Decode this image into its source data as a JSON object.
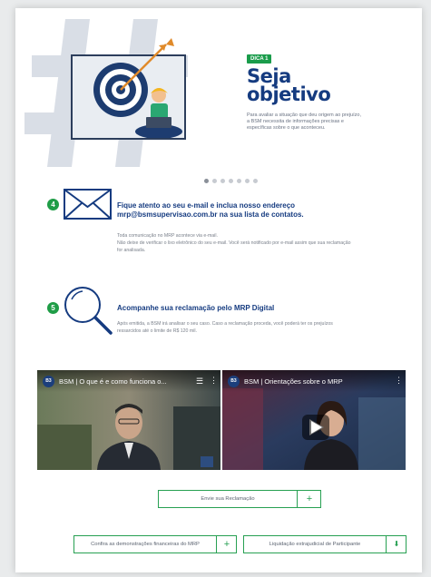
{
  "tip": {
    "badge": "DICA 1",
    "title_line1": "Seja",
    "title_line2": "objetivo",
    "description": "Para avaliar a situação que deu origem ao prejuízo, a BSM necessita de informações precisas e específicas sobre o que aconteceu."
  },
  "carousel": {
    "dot_count": 7,
    "active_index": 0
  },
  "step4": {
    "number": "4",
    "title_line1": "Fique atento ao seu e-mail e inclua nosso endereço",
    "title_line2": "mrp@bsmsupervisao.com.br na sua lista de contatos.",
    "text_line1": "Toda comunicação no MRP acontece via e-mail.",
    "text_line2": "Não deixe de verificar o lixo eletrônico do seu e-mail. Você será notificado por e-mail assim que sua reclamação",
    "text_line3": "for analisada."
  },
  "step5": {
    "number": "5",
    "title": "Acompanhe sua reclamação pelo MRP Digital",
    "text_line1": "Após emitida, a BSM irá analisar o seu caso. Caso a reclamação proceda, você poderá ter os prejuízos",
    "text_line2": "ressarcidos até o limite de R$ 120 mil."
  },
  "videos": [
    {
      "logo": "B3",
      "title": "BSM | O que é e como funciona o..."
    },
    {
      "logo": "B3",
      "title": "BSM | Orientações sobre o MRP"
    }
  ],
  "buttons": {
    "send": {
      "label": "Envie sua Reclamação",
      "icon": "+"
    },
    "financial": {
      "label": "Confira as demonstrações financeiras do MRP",
      "icon": "+"
    },
    "liquidation": {
      "label": "Liquidação extrajudicial de Participante",
      "icon": "⬇"
    }
  },
  "colors": {
    "brand_blue": "#153b80",
    "accent_green": "#1f9d47",
    "button_border": "#27a052"
  }
}
